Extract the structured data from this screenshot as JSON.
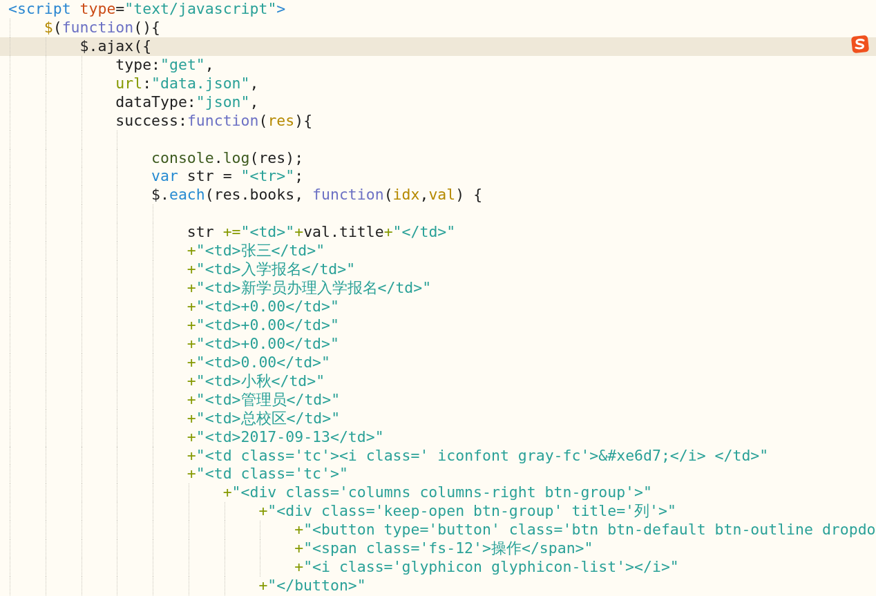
{
  "editor": {
    "lines": [
      {
        "kind": "code",
        "current": false,
        "tokens": [
          {
            "kind": "tag",
            "text": "<script"
          },
          {
            "kind": "attr",
            "text": " type"
          },
          {
            "kind": "p",
            "text": "="
          },
          {
            "kind": "str",
            "text": "\"text/javascript\""
          },
          {
            "kind": "tag",
            "text": ">"
          }
        ],
        "children": [
          {
            "kind": "code",
            "current": false,
            "tokens": [
              {
                "kind": "dl",
                "text": "$"
              },
              {
                "kind": "p",
                "text": "("
              },
              {
                "kind": "kw",
                "text": "function"
              },
              {
                "kind": "p",
                "text": "(){"
              }
            ],
            "children": [
              {
                "kind": "code",
                "current": true,
                "tokens": [
                  {
                    "kind": "p",
                    "text": "$.ajax({"
                  }
                ],
                "children": [
                  {
                    "kind": "code",
                    "current": false,
                    "tokens": [
                      {
                        "kind": "p",
                        "text": "type:"
                      },
                      {
                        "kind": "str",
                        "text": "\"get\""
                      },
                      {
                        "kind": "p",
                        "text": ","
                      }
                    ]
                  },
                  {
                    "kind": "code",
                    "current": false,
                    "tokens": [
                      {
                        "kind": "op",
                        "text": "url"
                      },
                      {
                        "kind": "p",
                        "text": ":"
                      },
                      {
                        "kind": "str",
                        "text": "\"data.json\""
                      },
                      {
                        "kind": "p",
                        "text": ","
                      }
                    ]
                  },
                  {
                    "kind": "code",
                    "current": false,
                    "tokens": [
                      {
                        "kind": "p",
                        "text": "dataType:"
                      },
                      {
                        "kind": "str",
                        "text": "\"json\""
                      },
                      {
                        "kind": "p",
                        "text": ","
                      }
                    ]
                  },
                  {
                    "kind": "code",
                    "current": false,
                    "tokens": [
                      {
                        "kind": "p",
                        "text": "success:"
                      },
                      {
                        "kind": "kw",
                        "text": "function"
                      },
                      {
                        "kind": "p",
                        "text": "("
                      },
                      {
                        "kind": "dl",
                        "text": "res"
                      },
                      {
                        "kind": "p",
                        "text": "){"
                      }
                    ],
                    "children": [
                      {
                        "kind": "blank",
                        "current": false
                      },
                      {
                        "kind": "code",
                        "current": false,
                        "tokens": [
                          {
                            "kind": "bi",
                            "text": "console"
                          },
                          {
                            "kind": "p",
                            "text": "."
                          },
                          {
                            "kind": "bi",
                            "text": "log"
                          },
                          {
                            "kind": "p",
                            "text": "(res);"
                          }
                        ]
                      },
                      {
                        "kind": "code",
                        "current": false,
                        "tokens": [
                          {
                            "kind": "fn",
                            "text": "var"
                          },
                          {
                            "kind": "p",
                            "text": " str = "
                          },
                          {
                            "kind": "str",
                            "text": "\"<tr>\""
                          },
                          {
                            "kind": "p",
                            "text": ";"
                          }
                        ]
                      },
                      {
                        "kind": "code",
                        "current": false,
                        "tokens": [
                          {
                            "kind": "p",
                            "text": "$."
                          },
                          {
                            "kind": "fn",
                            "text": "each"
                          },
                          {
                            "kind": "p",
                            "text": "(res.books, "
                          },
                          {
                            "kind": "kw",
                            "text": "function"
                          },
                          {
                            "kind": "p",
                            "text": "("
                          },
                          {
                            "kind": "dl",
                            "text": "idx"
                          },
                          {
                            "kind": "p",
                            "text": ","
                          },
                          {
                            "kind": "dl",
                            "text": "val"
                          },
                          {
                            "kind": "p",
                            "text": ") {"
                          }
                        ],
                        "children": [
                          {
                            "kind": "blank",
                            "current": false
                          },
                          {
                            "kind": "code",
                            "current": false,
                            "tokens": [
                              {
                                "kind": "p",
                                "text": "str "
                              },
                              {
                                "kind": "op",
                                "text": "+="
                              },
                              {
                                "kind": "str",
                                "text": "\"<td>\""
                              },
                              {
                                "kind": "op",
                                "text": "+"
                              },
                              {
                                "kind": "p",
                                "text": "val.title"
                              },
                              {
                                "kind": "op",
                                "text": "+"
                              },
                              {
                                "kind": "str",
                                "text": "\"</td>\""
                              }
                            ]
                          },
                          {
                            "kind": "code",
                            "current": false,
                            "tokens": [
                              {
                                "kind": "op",
                                "text": "+"
                              },
                              {
                                "kind": "str",
                                "text": "\"<td>张三</td>\""
                              }
                            ]
                          },
                          {
                            "kind": "code",
                            "current": false,
                            "tokens": [
                              {
                                "kind": "op",
                                "text": "+"
                              },
                              {
                                "kind": "str",
                                "text": "\"<td>入学报名</td>\""
                              }
                            ]
                          },
                          {
                            "kind": "code",
                            "current": false,
                            "tokens": [
                              {
                                "kind": "op",
                                "text": "+"
                              },
                              {
                                "kind": "str",
                                "text": "\"<td>新学员办理入学报名</td>\""
                              }
                            ]
                          },
                          {
                            "kind": "code",
                            "current": false,
                            "tokens": [
                              {
                                "kind": "op",
                                "text": "+"
                              },
                              {
                                "kind": "str",
                                "text": "\"<td>+0.00</td>\""
                              }
                            ]
                          },
                          {
                            "kind": "code",
                            "current": false,
                            "tokens": [
                              {
                                "kind": "op",
                                "text": "+"
                              },
                              {
                                "kind": "str",
                                "text": "\"<td>+0.00</td>\""
                              }
                            ]
                          },
                          {
                            "kind": "code",
                            "current": false,
                            "tokens": [
                              {
                                "kind": "op",
                                "text": "+"
                              },
                              {
                                "kind": "str",
                                "text": "\"<td>+0.00</td>\""
                              }
                            ]
                          },
                          {
                            "kind": "code",
                            "current": false,
                            "tokens": [
                              {
                                "kind": "op",
                                "text": "+"
                              },
                              {
                                "kind": "str",
                                "text": "\"<td>0.00</td>\""
                              }
                            ]
                          },
                          {
                            "kind": "code",
                            "current": false,
                            "tokens": [
                              {
                                "kind": "op",
                                "text": "+"
                              },
                              {
                                "kind": "str",
                                "text": "\"<td>小秋</td>\""
                              }
                            ]
                          },
                          {
                            "kind": "code",
                            "current": false,
                            "tokens": [
                              {
                                "kind": "op",
                                "text": "+"
                              },
                              {
                                "kind": "str",
                                "text": "\"<td>管理员</td>\""
                              }
                            ]
                          },
                          {
                            "kind": "code",
                            "current": false,
                            "tokens": [
                              {
                                "kind": "op",
                                "text": "+"
                              },
                              {
                                "kind": "str",
                                "text": "\"<td>总校区</td>\""
                              }
                            ]
                          },
                          {
                            "kind": "code",
                            "current": false,
                            "tokens": [
                              {
                                "kind": "op",
                                "text": "+"
                              },
                              {
                                "kind": "str",
                                "text": "\"<td>2017-09-13</td>\""
                              }
                            ]
                          },
                          {
                            "kind": "code",
                            "current": false,
                            "tokens": [
                              {
                                "kind": "op",
                                "text": "+"
                              },
                              {
                                "kind": "str",
                                "text": "\"<td class='tc'><i class=' iconfont gray-fc'>&#xe6d7;</i> </td>\""
                              }
                            ]
                          },
                          {
                            "kind": "code",
                            "current": false,
                            "tokens": [
                              {
                                "kind": "op",
                                "text": "+"
                              },
                              {
                                "kind": "str",
                                "text": "\"<td class='tc'>\""
                              }
                            ],
                            "children": [
                              {
                                "kind": "code",
                                "current": false,
                                "tokens": [
                                  {
                                    "kind": "op",
                                    "text": "+"
                                  },
                                  {
                                    "kind": "str",
                                    "text": "\"<div class='columns columns-right btn-group'>\""
                                  }
                                ],
                                "children": [
                                  {
                                    "kind": "code",
                                    "current": false,
                                    "tokens": [
                                      {
                                        "kind": "op",
                                        "text": "+"
                                      },
                                      {
                                        "kind": "str",
                                        "text": "\"<div class='keep-open btn-group' title='列'>\""
                                      }
                                    ],
                                    "children": [
                                      {
                                        "kind": "code",
                                        "current": false,
                                        "tokens": [
                                          {
                                            "kind": "op",
                                            "text": "+"
                                          },
                                          {
                                            "kind": "str",
                                            "text": "\"<button type='button' class='btn btn-default btn-outline dropdo"
                                          }
                                        ]
                                      },
                                      {
                                        "kind": "code",
                                        "current": false,
                                        "tokens": [
                                          {
                                            "kind": "op",
                                            "text": "+"
                                          },
                                          {
                                            "kind": "str",
                                            "text": "\"<span class='fs-12'>操作</span>\""
                                          }
                                        ]
                                      },
                                      {
                                        "kind": "code",
                                        "current": false,
                                        "tokens": [
                                          {
                                            "kind": "op",
                                            "text": "+"
                                          },
                                          {
                                            "kind": "str",
                                            "text": "\"<i class='glyphicon glyphicon-list'></i>\""
                                          }
                                        ]
                                      }
                                    ]
                                  },
                                  {
                                    "kind": "code",
                                    "current": false,
                                    "tokens": [
                                      {
                                        "kind": "op",
                                        "text": "+"
                                      },
                                      {
                                        "kind": "str",
                                        "text": "\"</button>\""
                                      }
                                    ]
                                  }
                                ]
                              }
                            ]
                          }
                        ]
                      }
                    ]
                  }
                ]
              }
            ]
          }
        ]
      }
    ]
  }
}
